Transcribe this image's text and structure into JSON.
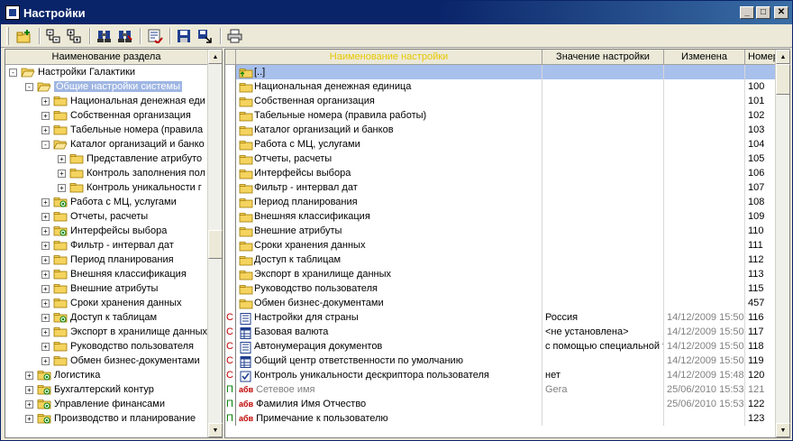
{
  "window": {
    "title": "Настройки"
  },
  "toolbar": {
    "buttons": [
      "new-folder-icon",
      "collapse-icon",
      "expand-icon",
      "find-icon",
      "find-next-icon",
      "history-icon",
      "save-icon",
      "export-icon",
      "print-icon"
    ]
  },
  "tree": {
    "header": "Наименование раздела",
    "items": [
      {
        "label": "Настройки Галактики",
        "level": 0,
        "pm": "-",
        "open": true
      },
      {
        "label": "Общие настройки системы",
        "level": 1,
        "pm": "-",
        "open": true,
        "selected": true
      },
      {
        "label": "Национальная денежная еди",
        "level": 2,
        "pm": "+"
      },
      {
        "label": "Собственная организация",
        "level": 2,
        "pm": "+"
      },
      {
        "label": "Табельные номера (правила",
        "level": 2,
        "pm": "+"
      },
      {
        "label": "Каталог организаций и банко",
        "level": 2,
        "pm": "-",
        "open": true
      },
      {
        "label": "Представление атрибуто",
        "level": 3,
        "pm": "+"
      },
      {
        "label": "Контроль заполнения пол",
        "level": 3,
        "pm": "+"
      },
      {
        "label": "Контроль уникальности г",
        "level": 3,
        "pm": "+"
      },
      {
        "label": "Работа с МЦ, услугами",
        "level": 2,
        "pm": "+",
        "badge": true
      },
      {
        "label": "Отчеты, расчеты",
        "level": 2,
        "pm": "+"
      },
      {
        "label": "Интерфейсы выбора",
        "level": 2,
        "pm": "+",
        "badge": true
      },
      {
        "label": "Фильтр - интервал дат",
        "level": 2,
        "pm": "+"
      },
      {
        "label": "Период планирования",
        "level": 2,
        "pm": "+"
      },
      {
        "label": "Внешняя классификация",
        "level": 2,
        "pm": "+"
      },
      {
        "label": "Внешние атрибуты",
        "level": 2,
        "pm": "+"
      },
      {
        "label": "Сроки хранения данных",
        "level": 2,
        "pm": "+"
      },
      {
        "label": "Доступ к таблицам",
        "level": 2,
        "pm": "+",
        "badge": true
      },
      {
        "label": "Экспорт в хранилище данных",
        "level": 2,
        "pm": "+"
      },
      {
        "label": "Руководство пользователя",
        "level": 2,
        "pm": "+"
      },
      {
        "label": "Обмен бизнес-документами",
        "level": 2,
        "pm": "+"
      },
      {
        "label": "Логистика",
        "level": 1,
        "pm": "+",
        "badge": true
      },
      {
        "label": "Бухгалтерский контур",
        "level": 1,
        "pm": "+",
        "badge": true
      },
      {
        "label": "Управление финансами",
        "level": 1,
        "pm": "+",
        "badge": true
      },
      {
        "label": "Производство и планирование",
        "level": 1,
        "pm": "+",
        "badge": true
      }
    ]
  },
  "grid": {
    "headers": [
      "Наименование настройки",
      "Значение настройки",
      "Изменена",
      "Номер"
    ],
    "rows": [
      {
        "flag": "",
        "icon": "up-folder",
        "name": "[..]",
        "value": "",
        "changed": "",
        "num": "",
        "selected": true
      },
      {
        "flag": "",
        "icon": "folder",
        "name": "Национальная денежная единица",
        "value": "",
        "changed": "",
        "num": "100"
      },
      {
        "flag": "",
        "icon": "folder",
        "name": "Собственная организация",
        "value": "",
        "changed": "",
        "num": "101"
      },
      {
        "flag": "",
        "icon": "folder",
        "name": "Табельные номера (правила работы)",
        "value": "",
        "changed": "",
        "num": "102"
      },
      {
        "flag": "",
        "icon": "folder",
        "name": "Каталог организаций и банков",
        "value": "",
        "changed": "",
        "num": "103"
      },
      {
        "flag": "",
        "icon": "folder",
        "name": "Работа с МЦ, услугами",
        "value": "",
        "changed": "",
        "num": "104"
      },
      {
        "flag": "",
        "icon": "folder",
        "name": "Отчеты, расчеты",
        "value": "",
        "changed": "",
        "num": "105"
      },
      {
        "flag": "",
        "icon": "folder",
        "name": "Интерфейсы выбора",
        "value": "",
        "changed": "",
        "num": "106"
      },
      {
        "flag": "",
        "icon": "folder",
        "name": "Фильтр - интервал дат",
        "value": "",
        "changed": "",
        "num": "107"
      },
      {
        "flag": "",
        "icon": "folder",
        "name": "Период планирования",
        "value": "",
        "changed": "",
        "num": "108"
      },
      {
        "flag": "",
        "icon": "folder",
        "name": "Внешняя классификация",
        "value": "",
        "changed": "",
        "num": "109"
      },
      {
        "flag": "",
        "icon": "folder",
        "name": "Внешние атрибуты",
        "value": "",
        "changed": "",
        "num": "110"
      },
      {
        "flag": "",
        "icon": "folder",
        "name": "Сроки хранения данных",
        "value": "",
        "changed": "",
        "num": "111"
      },
      {
        "flag": "",
        "icon": "folder",
        "name": "Доступ к таблицам",
        "value": "",
        "changed": "",
        "num": "112"
      },
      {
        "flag": "",
        "icon": "folder",
        "name": "Экспорт в хранилище данных",
        "value": "",
        "changed": "",
        "num": "113"
      },
      {
        "flag": "",
        "icon": "folder",
        "name": "Руководство пользователя",
        "value": "",
        "changed": "",
        "num": "115"
      },
      {
        "flag": "",
        "icon": "folder",
        "name": "Обмен бизнес-документами",
        "value": "",
        "changed": "",
        "num": "457"
      },
      {
        "flag": "С",
        "icon": "form",
        "name": "Настройки для страны",
        "value": "Россия",
        "changed": "14/12/2009 15:50",
        "num": "116"
      },
      {
        "flag": "С",
        "icon": "table",
        "name": "Базовая валюта",
        "value": "<не установлена>",
        "changed": "14/12/2009 15:50",
        "num": "117"
      },
      {
        "flag": "С",
        "icon": "form",
        "name": "Автонумерация документов",
        "value": "с помощью специальной т",
        "changed": "14/12/2009 15:50",
        "num": "118"
      },
      {
        "flag": "С",
        "icon": "table",
        "name": "Общий центр ответственности по умолчанию",
        "value": "",
        "changed": "14/12/2009 15:50",
        "num": "119"
      },
      {
        "flag": "С",
        "icon": "check",
        "name": "Контроль уникальности дескриптора пользователя",
        "value": "нет",
        "changed": "14/12/2009 15:48",
        "num": "120"
      },
      {
        "flag": "П",
        "icon": "abv",
        "name": "Сетевое имя",
        "value": "Gera",
        "changed": "25/06/2010 15:53",
        "num": "121",
        "muted": true
      },
      {
        "flag": "П",
        "icon": "abv",
        "name": "Фамилия Имя Отчество",
        "value": "",
        "changed": "25/06/2010 15:53",
        "num": "122"
      },
      {
        "flag": "П",
        "icon": "abv",
        "name": "Примечание к пользователю",
        "value": "",
        "changed": "",
        "num": "123"
      }
    ]
  },
  "icons": {
    "abv_text": "абв"
  }
}
